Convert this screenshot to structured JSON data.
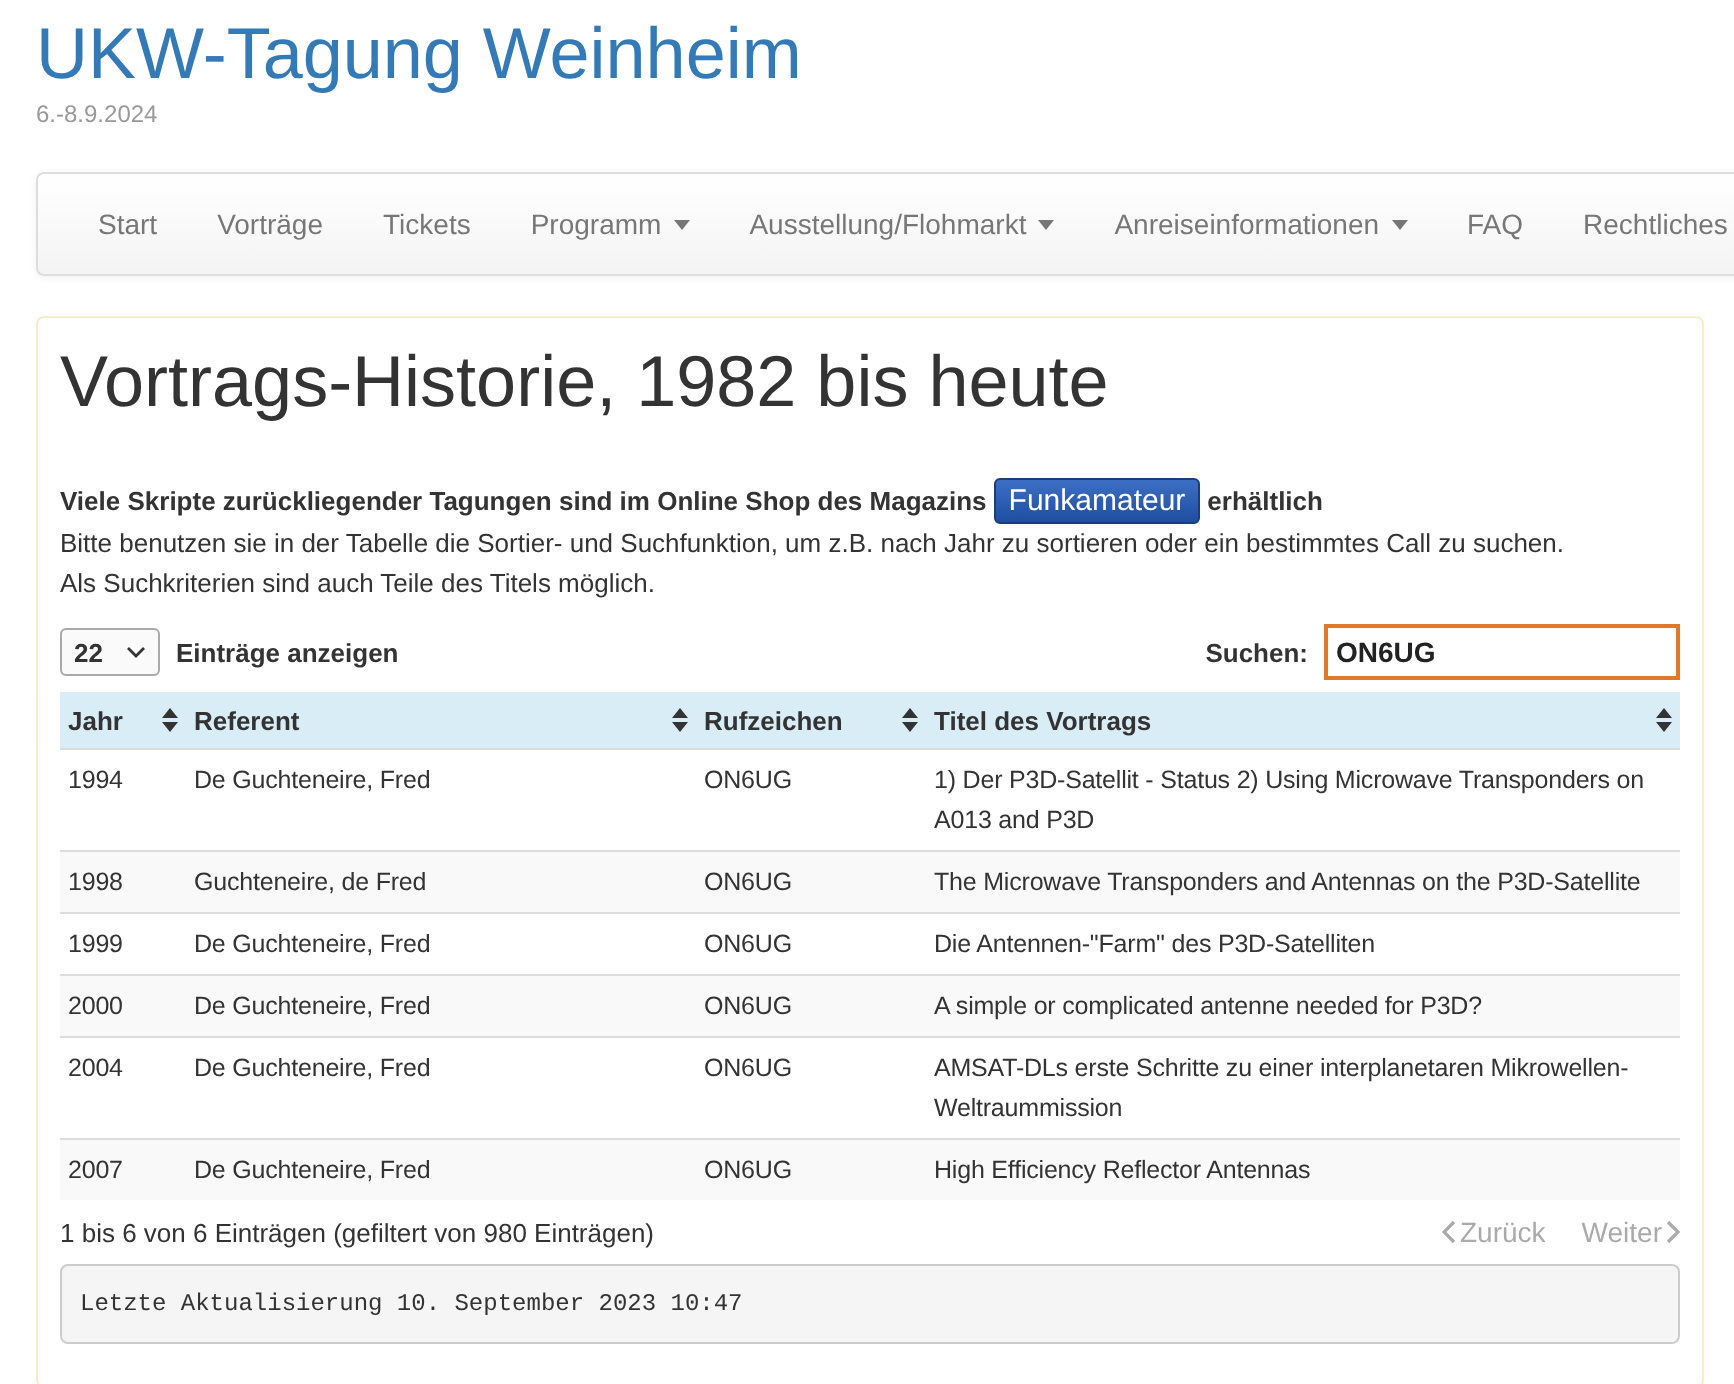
{
  "site": {
    "title": "UKW-Tagung Weinheim",
    "date": "6.-8.9.2024"
  },
  "nav": [
    {
      "label": "Start",
      "dropdown": false
    },
    {
      "label": "Vorträge",
      "dropdown": false
    },
    {
      "label": "Tickets",
      "dropdown": false
    },
    {
      "label": "Programm",
      "dropdown": true
    },
    {
      "label": "Ausstellung/Flohmarkt",
      "dropdown": true
    },
    {
      "label": "Anreiseinformationen",
      "dropdown": true
    },
    {
      "label": "FAQ",
      "dropdown": false
    },
    {
      "label": "Rechtliches",
      "dropdown": false
    }
  ],
  "heading": "Vortrags-Historie, 1982 bis heute",
  "intro": {
    "before": "Viele Skripte zurückliegender Tagungen sind im Online Shop des Magazins",
    "button": "Funkamateur",
    "after": "erhältlich",
    "lines": [
      "Bitte benutzen sie in der Tabelle die Sortier- und Suchfunktion, um z.B. nach Jahr zu sortieren oder ein bestimmtes Call zu suchen.",
      "Als Suchkriterien sind auch Teile des Titels möglich."
    ]
  },
  "length": {
    "value": "22",
    "label": "Einträge anzeigen"
  },
  "search": {
    "label": "Suchen:",
    "value": "ON6UG"
  },
  "table": {
    "columns": [
      "Jahr",
      "Referent",
      "Rufzeichen",
      "Titel des Vortrags"
    ],
    "rows": [
      [
        "1994",
        "De Guchteneire, Fred",
        "ON6UG",
        "1) Der P3D-Satellit - Status 2) Using Microwave Transponders on A013 and P3D"
      ],
      [
        "1998",
        "Guchteneire, de Fred",
        "ON6UG",
        "The Microwave Transponders and Antennas on the P3D-Satellite"
      ],
      [
        "1999",
        "De Guchteneire, Fred",
        "ON6UG",
        "Die Antennen-\"Farm\" des P3D-Satelliten"
      ],
      [
        "2000",
        "De Guchteneire, Fred",
        "ON6UG",
        "A simple or complicated antenne needed for P3D?"
      ],
      [
        "2004",
        "De Guchteneire, Fred",
        "ON6UG",
        "AMSAT-DLs erste Schritte zu einer interplanetaren Mikrowellen-Weltraummission"
      ],
      [
        "2007",
        "De Guchteneire, Fred",
        "ON6UG",
        "High Efficiency Reflector Antennas"
      ]
    ]
  },
  "info": "1 bis 6 von 6 Einträgen (gefiltert von 980 Einträgen)",
  "pager": [
    {
      "label": "Zurück",
      "disabled": true
    },
    {
      "label": "Weiter",
      "disabled": true
    }
  ],
  "footer": "Letzte Aktualisierung 10. September 2023 10:47"
}
